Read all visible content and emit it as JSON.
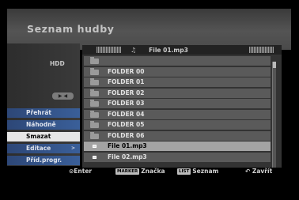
{
  "header": {
    "title": "Seznam hudby"
  },
  "left_panel": {
    "device": "HDD",
    "menu": [
      {
        "label": "Přehrát",
        "selected": false
      },
      {
        "label": "Náhodně",
        "selected": false
      },
      {
        "label": "Smazat",
        "selected": true
      },
      {
        "label": "Editace",
        "selected": false
      },
      {
        "label": "Příd.progr.",
        "selected": false
      }
    ]
  },
  "file_browser": {
    "current_file": "File 01.mp3",
    "items": [
      {
        "type": "parent-folder",
        "label": ""
      },
      {
        "type": "folder",
        "label": "FOLDER 00"
      },
      {
        "type": "folder",
        "label": "FOLDER 01"
      },
      {
        "type": "folder",
        "label": "FOLDER 02"
      },
      {
        "type": "folder",
        "label": "FOLDER 03"
      },
      {
        "type": "folder",
        "label": "FOLDER 04"
      },
      {
        "type": "folder",
        "label": "FOLDER 05"
      },
      {
        "type": "folder",
        "label": "FOLDER 06"
      },
      {
        "type": "file",
        "label": "File 01.mp3",
        "selected": true
      },
      {
        "type": "file",
        "label": "File 02.mp3"
      }
    ]
  },
  "footer": {
    "enter_label": "Enter",
    "marker_key": "MARKER",
    "marker_label": "Značka",
    "list_key": "LIST",
    "list_label": "Seznam",
    "close_label": "Zavřít"
  }
}
